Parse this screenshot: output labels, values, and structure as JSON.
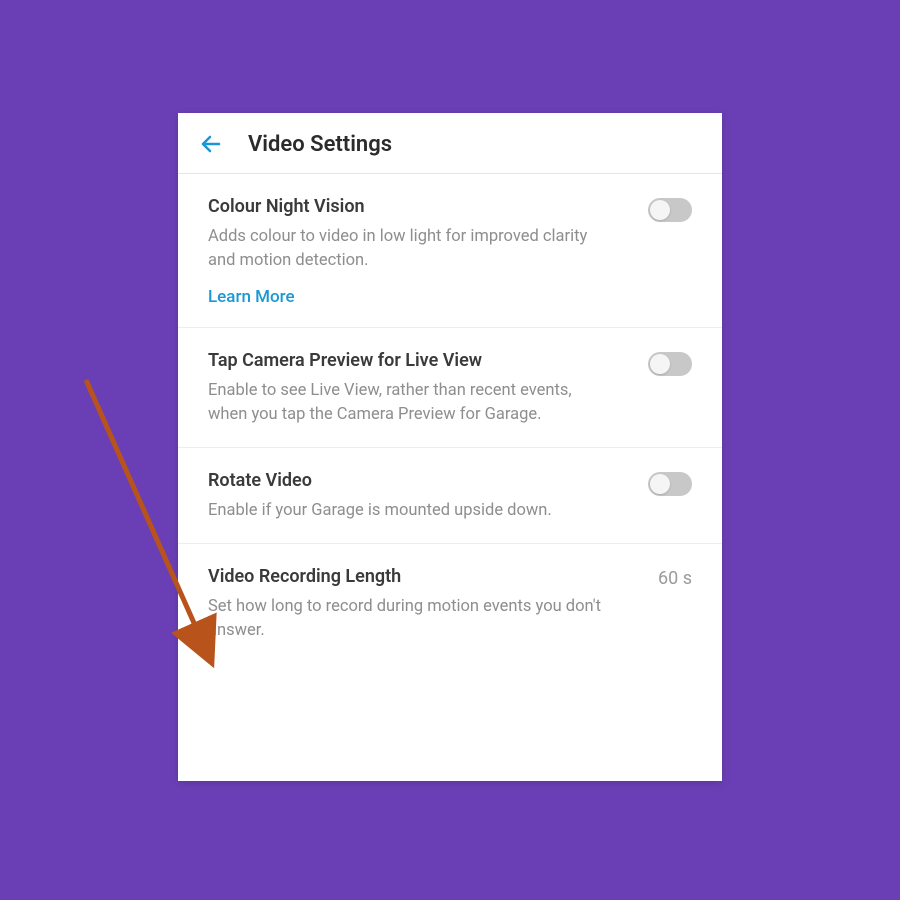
{
  "header": {
    "title": "Video Settings"
  },
  "settings": {
    "colourNightVision": {
      "title": "Colour Night Vision",
      "description": "Adds colour to video in low light for improved clarity and motion detection.",
      "learnMore": "Learn More"
    },
    "tapCameraPreview": {
      "title": "Tap Camera Preview for Live View",
      "description": "Enable to see Live View, rather than recent events, when you tap the Camera Preview for Garage."
    },
    "rotateVideo": {
      "title": "Rotate Video",
      "description": "Enable if your Garage is mounted upside down."
    },
    "videoRecordingLength": {
      "title": "Video Recording Length",
      "description": "Set how long to record during motion events you don't answer.",
      "value": "60 s"
    }
  }
}
